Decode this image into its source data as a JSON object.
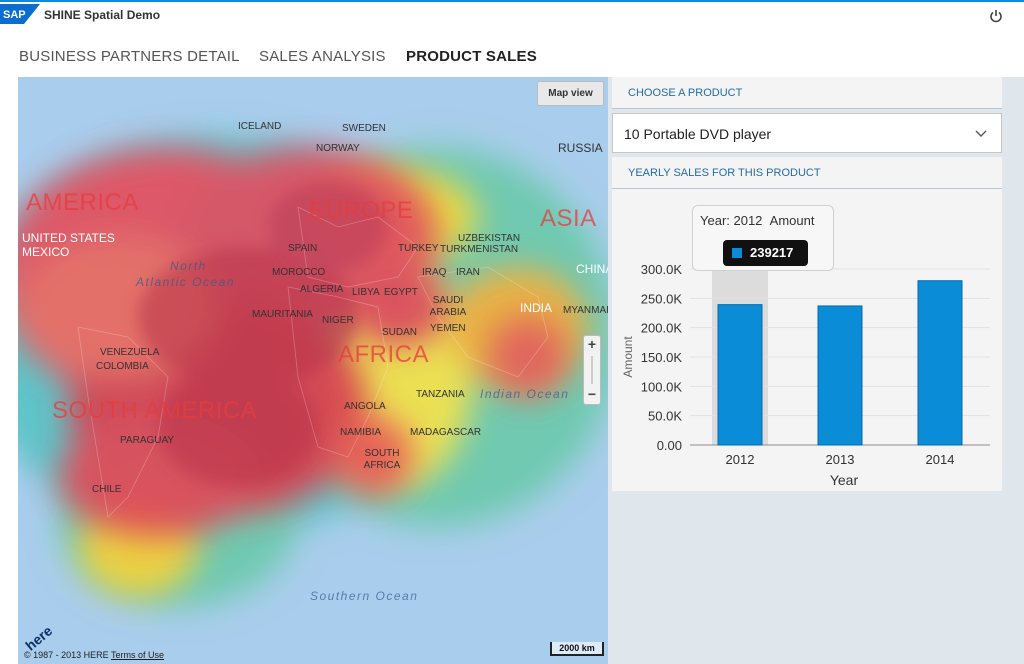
{
  "shell": {
    "logo_text": "SAP",
    "app_title": "SHINE Spatial Demo",
    "power_icon": "power-icon"
  },
  "tabs": [
    {
      "label": "BUSINESS PARTNERS DETAIL",
      "active": false
    },
    {
      "label": "SALES ANALYSIS",
      "active": false
    },
    {
      "label": "PRODUCT SALES",
      "active": true
    }
  ],
  "map": {
    "view_button": "Map view",
    "continents": [
      "AMERICA",
      "EUROPE",
      "ASIA",
      "AFRICA",
      "SOUTH AMERICA"
    ],
    "oceans": [
      "North Atlantic Ocean",
      "Indian Ocean",
      "Southern Ocean"
    ],
    "countries": [
      "ICELAND",
      "SWEDEN",
      "NORWAY",
      "RUSSIA",
      "UNITED STATES",
      "MEXICO",
      "SPAIN",
      "TURKEY",
      "UZBEKISTAN",
      "TURKMENISTAN",
      "CHINA",
      "MOROCCO",
      "IRAQ",
      "IRAN",
      "ALGERIA",
      "LIBYA",
      "EGYPT",
      "SAUDI ARABIA",
      "INDIA",
      "MYANMAR",
      "MAURITANIA",
      "NIGER",
      "YEMEN",
      "SUDAN",
      "VENEZUELA",
      "COLOMBIA",
      "TANZANIA",
      "ANGOLA",
      "NAMIBIA",
      "MADAGASCAR",
      "SOUTH AFRICA",
      "PARAGUAY",
      "CHILE"
    ],
    "zoom_in": "+",
    "zoom_out": "−",
    "scale": "2000 km",
    "copyright": "© 1987 - 2013 HERE",
    "terms": "Terms of Use",
    "provider_logo": "here"
  },
  "product_section": {
    "header": "CHOOSE A PRODUCT",
    "selected": "10 Portable DVD player",
    "chevron_icon": "chevron-down-icon"
  },
  "sales_section": {
    "header": "YEARLY SALES FOR THIS PRODUCT",
    "tooltip": {
      "title_year_label": "Year: 2012",
      "title_measure": "Amount",
      "value": "239217"
    }
  },
  "colors": {
    "bar": "#0a8dd6",
    "accent": "#236ca8",
    "highlight": "#dcdcdc"
  },
  "chart_data": {
    "type": "bar",
    "categories": [
      "2012",
      "2013",
      "2014"
    ],
    "values": [
      239217,
      237000,
      280000
    ],
    "xlabel": "Year",
    "ylabel": "Amount",
    "ylim": [
      0,
      300000
    ],
    "ytick_labels": [
      "0.00",
      "50.0K",
      "100.0K",
      "150.0K",
      "200.0K",
      "250.0K",
      "300.0K"
    ],
    "highlighted_category": "2012",
    "grid": true
  }
}
